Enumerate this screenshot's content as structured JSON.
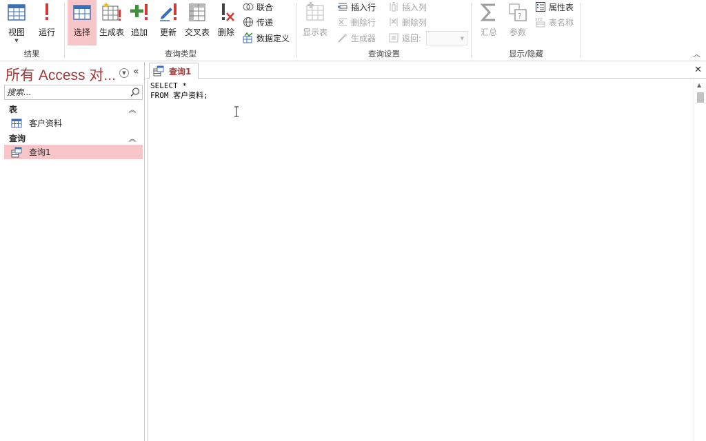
{
  "colors": {
    "accent": "#a4373a",
    "selection": "#f8c6c9",
    "icon_blue": "#3b6fb6",
    "icon_red": "#d23a3a",
    "icon_green": "#3f8f3f",
    "disabled": "#a6a6a6"
  },
  "ribbon": {
    "groups": {
      "results": "结果",
      "query_type": "查询类型",
      "query_setup": "查询设置",
      "show_hide": "显示/隐藏"
    },
    "view": {
      "label": "视图",
      "icon": "datasheet-view-icon"
    },
    "run": {
      "label": "运行",
      "icon": "run-icon"
    },
    "select": {
      "label": "选择",
      "icon": "select-query-icon"
    },
    "make_table": {
      "label": "生成表",
      "icon": "make-table-icon"
    },
    "append": {
      "label": "追加",
      "icon": "append-icon"
    },
    "update": {
      "label": "更新",
      "icon": "update-icon"
    },
    "crosstab": {
      "label": "交叉表",
      "icon": "crosstab-icon"
    },
    "delete": {
      "label": "删除",
      "icon": "delete-query-icon"
    },
    "union": {
      "label": "联合",
      "icon": "union-icon"
    },
    "pass_through": {
      "label": "传递",
      "icon": "pass-through-icon"
    },
    "data_definition": {
      "label": "数据定义",
      "icon": "data-definition-icon"
    },
    "show_table": {
      "label": "显示表",
      "icon": "show-table-icon"
    },
    "insert_rows": {
      "label": "插入行",
      "icon": "insert-rows-icon"
    },
    "delete_rows": {
      "label": "删除行",
      "icon": "delete-rows-icon"
    },
    "builder": {
      "label": "生成器",
      "icon": "builder-icon"
    },
    "insert_columns": {
      "label": "插入列",
      "icon": "insert-columns-icon"
    },
    "delete_columns": {
      "label": "删除列",
      "icon": "delete-columns-icon"
    },
    "return": {
      "label": "返回:",
      "icon": "return-icon",
      "value": ""
    },
    "totals": {
      "label": "汇总",
      "icon": "sigma-icon"
    },
    "parameters": {
      "label": "参数",
      "icon": "parameters-icon"
    },
    "property_sheet": {
      "label": "属性表",
      "icon": "property-sheet-icon"
    },
    "table_names": {
      "label": "表名称",
      "icon": "table-names-icon"
    }
  },
  "nav": {
    "title": "所有 Access 对...",
    "search_placeholder": "搜索...",
    "groups": [
      {
        "label": "表",
        "items": [
          {
            "label": "客户资料",
            "icon": "table-icon"
          }
        ]
      },
      {
        "label": "查询",
        "items": [
          {
            "label": "查询1",
            "icon": "query-icon",
            "selected": true
          }
        ]
      }
    ]
  },
  "document": {
    "tab_label": "查询1",
    "sql_text": "SELECT *\nFROM 客户资料;"
  }
}
